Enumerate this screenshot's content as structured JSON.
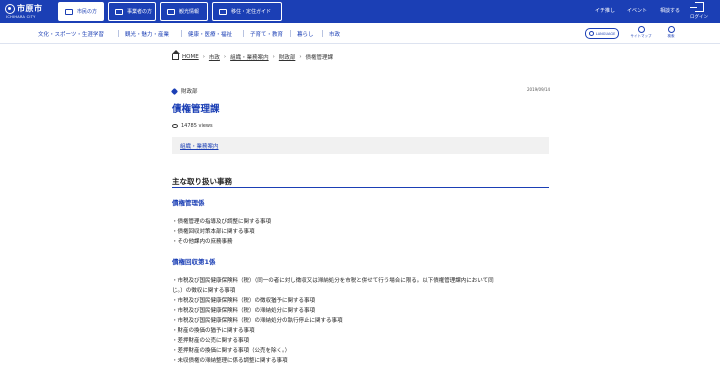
{
  "header": {
    "logo_ja": "市原市",
    "logo_en": "ICHIHARA CITY",
    "tabs": [
      {
        "label": "市民の方",
        "active": true
      },
      {
        "label": "事業者の方",
        "active": false
      },
      {
        "label": "観光情報",
        "active": false
      },
      {
        "label": "移住・定住ガイド",
        "active": false
      }
    ],
    "links": [
      "イチ推し",
      "イベント",
      "相談する"
    ],
    "login_label": "ログイン"
  },
  "global_nav": {
    "items": [
      "文化・スポーツ・生涯学習",
      "観光・魅力・産業",
      "健康・医療・福祉",
      "子育て・教育",
      "暮らし",
      "市政"
    ],
    "language_label": "LANGUAGE",
    "sitemap_label": "サイトマップ",
    "search_label": "検索"
  },
  "breadcrumb": {
    "home": "HOME",
    "items": [
      "市政",
      "組織・業務案内",
      "財政部"
    ],
    "current": "債権管理課"
  },
  "article": {
    "department": "財政部",
    "date": "2019/09/14",
    "title": "債権管理課",
    "views": "14785 views",
    "related_link": "組織・業務案内",
    "section_title": "主な取り扱い事務",
    "groups": [
      {
        "heading": "債権管理係",
        "items": [
          "・債権管理の指導及び調整に関する事項",
          "・債権回収対策本部に関する事項",
          "・その他課内の庶務事務"
        ]
      },
      {
        "heading": "債権回収第1係",
        "items": [
          "・市税及び国民健康保険料（税）（同一の者に対し徴収又は滞納処分を市税と併せて行う場合に限る。以下債権管理課内において同",
          "じ。）の徴収に関する事項",
          "・市税及び国民健康保険料（税）の徴収猶予に関する事項",
          "・市税及び国民健康保険料（税）の滞納処分に関する事項",
          "・市税及び国民健康保険料（税）の滞納処分の執行停止に関する事項",
          "・財産の換価の猶予に関する事項",
          "・差押財産の公売に関する事項",
          "・差押財産の換価に関する事項（公売を除く。）",
          "・未収債権の滞納整理に係る調整に関する事項"
        ]
      }
    ]
  },
  "colors": {
    "brand": "#1b3fb5"
  }
}
